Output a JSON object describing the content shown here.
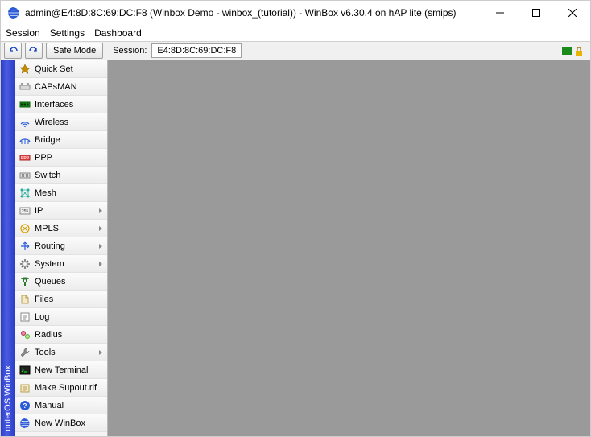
{
  "titlebar": {
    "text": "admin@E4:8D:8C:69:DC:F8 (Winbox Demo - winbox_(tutorial)) - WinBox v6.30.4 on hAP lite (smips)"
  },
  "menubar": {
    "items": [
      "Session",
      "Settings",
      "Dashboard"
    ]
  },
  "toolbar": {
    "safe_mode": "Safe Mode",
    "session_label": "Session:",
    "session_value": "E4:8D:8C:69:DC:F8"
  },
  "vtab": {
    "label": "outerOS WinBox"
  },
  "sidebar": {
    "items": [
      {
        "label": "Quick Set",
        "icon": "quickset",
        "submenu": false
      },
      {
        "label": "CAPsMAN",
        "icon": "capsman",
        "submenu": false
      },
      {
        "label": "Interfaces",
        "icon": "interfaces",
        "submenu": false
      },
      {
        "label": "Wireless",
        "icon": "wireless",
        "submenu": false
      },
      {
        "label": "Bridge",
        "icon": "bridge",
        "submenu": false
      },
      {
        "label": "PPP",
        "icon": "ppp",
        "submenu": false
      },
      {
        "label": "Switch",
        "icon": "switch",
        "submenu": false
      },
      {
        "label": "Mesh",
        "icon": "mesh",
        "submenu": false
      },
      {
        "label": "IP",
        "icon": "ip",
        "submenu": true
      },
      {
        "label": "MPLS",
        "icon": "mpls",
        "submenu": true
      },
      {
        "label": "Routing",
        "icon": "routing",
        "submenu": true
      },
      {
        "label": "System",
        "icon": "system",
        "submenu": true
      },
      {
        "label": "Queues",
        "icon": "queues",
        "submenu": false
      },
      {
        "label": "Files",
        "icon": "files",
        "submenu": false
      },
      {
        "label": "Log",
        "icon": "log",
        "submenu": false
      },
      {
        "label": "Radius",
        "icon": "radius",
        "submenu": false
      },
      {
        "label": "Tools",
        "icon": "tools",
        "submenu": true
      },
      {
        "label": "New Terminal",
        "icon": "terminal",
        "submenu": false
      },
      {
        "label": "Make Supout.rif",
        "icon": "supout",
        "submenu": false
      },
      {
        "label": "Manual",
        "icon": "manual",
        "submenu": false
      },
      {
        "label": "New WinBox",
        "icon": "winbox",
        "submenu": false
      }
    ]
  }
}
